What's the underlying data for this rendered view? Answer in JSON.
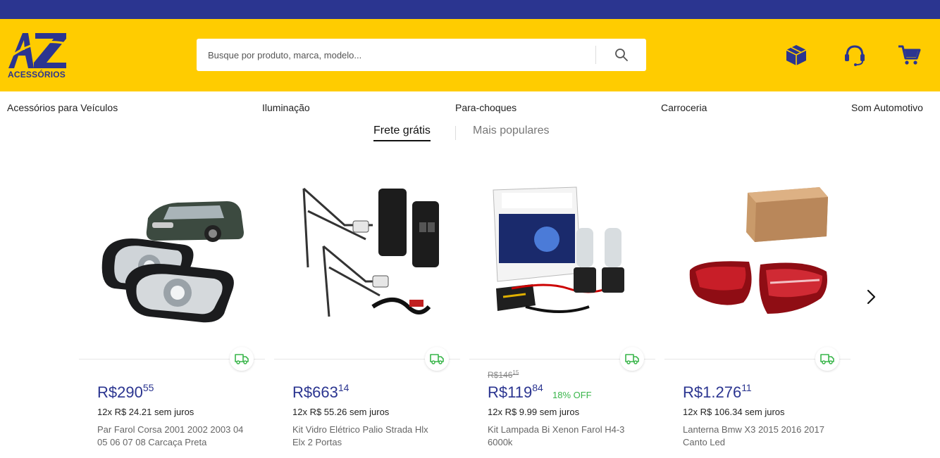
{
  "brand": {
    "name": "AZ",
    "subtitle": "ACESSÓRIOS",
    "primary_color": "#2b3590",
    "accent_color": "#ffcc00"
  },
  "search": {
    "placeholder": "Busque por produto, marca, modelo...",
    "value": ""
  },
  "header_icons": [
    "box-icon",
    "headset-icon",
    "cart-icon"
  ],
  "categories": [
    "Acessórios para Veículos",
    "Iluminação",
    "Para-choques",
    "Carroceria",
    "Som Automotivo"
  ],
  "tabs": [
    {
      "label": "Frete grátis",
      "active": true
    },
    {
      "label": "Mais populares",
      "active": false
    }
  ],
  "products": [
    {
      "currency": "R$",
      "price_int": "290",
      "price_cents": "55",
      "old_price": "",
      "old_cents": "",
      "discount": "",
      "installments": "12x R$ 24.21 sem juros",
      "name": "Par Farol Corsa 2001 2002 2003 04 05 06 07 08 Carcaça Preta",
      "free_shipping": true
    },
    {
      "currency": "R$",
      "price_int": "663",
      "price_cents": "14",
      "old_price": "",
      "old_cents": "",
      "discount": "",
      "installments": "12x R$ 55.26 sem juros",
      "name": "Kit Vidro Elétrico Palio Strada Hlx Elx 2 Portas",
      "free_shipping": true
    },
    {
      "currency": "R$",
      "price_int": "119",
      "price_cents": "84",
      "old_price": "R$146",
      "old_cents": "15",
      "discount": "18% OFF",
      "installments": "12x R$ 9.99 sem juros",
      "name": "Kit Lampada Bi Xenon Farol H4-3 6000k",
      "free_shipping": true
    },
    {
      "currency": "R$",
      "price_int": "1.276",
      "price_cents": "11",
      "old_price": "",
      "old_cents": "",
      "discount": "",
      "installments": "12x R$ 106.34 sem juros",
      "name": "Lanterna Bmw X3 2015 2016 2017 Canto Led",
      "free_shipping": true
    }
  ]
}
